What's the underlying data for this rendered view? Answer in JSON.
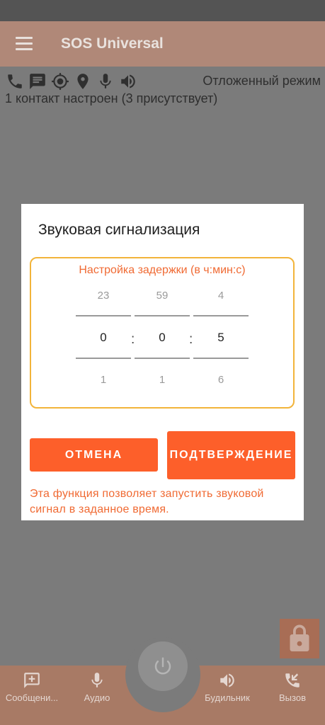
{
  "app": {
    "title": "SOS Universal",
    "menu_icon": "hamburger-menu-icon"
  },
  "status": {
    "icons": [
      "phone-icon",
      "message-icon",
      "gps-target-icon",
      "location-pin-icon",
      "microphone-icon",
      "speaker-icon"
    ],
    "mode": "Отложенный режим",
    "contacts": "1 контакт настроен (3 присутствует)"
  },
  "dialog": {
    "title": "Звуковая сигнализация",
    "picker_title": "Настройка задержки (в ч:мин:с)",
    "separator": ":",
    "hours": {
      "prev": "23",
      "current": "0",
      "next": "1"
    },
    "minutes": {
      "prev": "59",
      "current": "0",
      "next": "1"
    },
    "seconds": {
      "prev": "4",
      "current": "5",
      "next": "6"
    },
    "cancel_label": "ОТМЕНА",
    "confirm_label": "ПОДТВЕРЖДЕНИЕ",
    "note": "Эта функция позволяет запустить звуковой сигнал в заданное время."
  },
  "bottom_nav": {
    "items": [
      {
        "label": "Сообщени...",
        "icon": "message-add-icon"
      },
      {
        "label": "Аудио",
        "icon": "microphone-icon"
      },
      {
        "label": "Будильник",
        "icon": "speaker-icon"
      },
      {
        "label": "Вызов",
        "icon": "phone-callback-icon"
      }
    ],
    "power_icon": "power-icon"
  },
  "lock_icon": "lock-icon",
  "colors": {
    "accent": "#fd5f2a",
    "picker_border": "#f2b43a",
    "note_text": "#f06a33"
  }
}
